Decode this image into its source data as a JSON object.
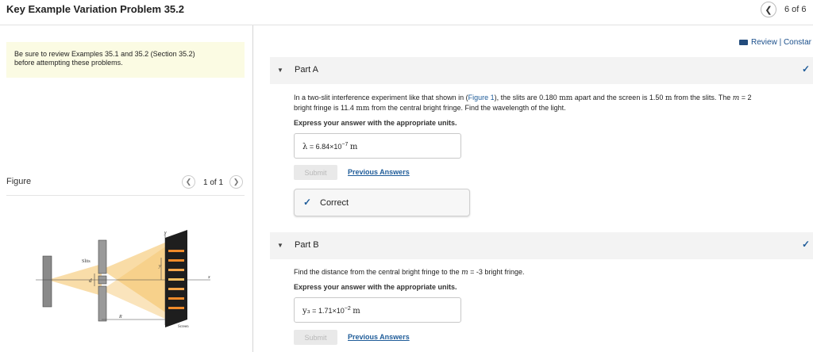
{
  "header": {
    "title": "Key Example Variation Problem 35.2",
    "prev_icon": "chevron-left",
    "page_count": "6 of 6"
  },
  "review_note": {
    "line1": "Be sure to review Examples 35.1 and 35.2 (Section 35.2)",
    "line2": "before attempting these problems."
  },
  "figure_panel": {
    "label": "Figure",
    "prev_icon": "chevron-left",
    "next_icon": "chevron-right",
    "count": "1 of 1",
    "labels": {
      "slits": "Slits",
      "y": "y",
      "y_sub": "y",
      "d": "d",
      "x": "x",
      "R": "R",
      "screen": "Screen"
    }
  },
  "review_link": {
    "icon": "book-icon",
    "text": "Review | Constar"
  },
  "part_a": {
    "label": "Part A",
    "q_line1_pre": "In a two-slit interference experiment like that shown in (",
    "figure_link": "Figure 1",
    "q_line1_post_a": "), the slits are 0.180 ",
    "unit_mm": "mm",
    "q_line1_post_b": " apart and the screen is 1.50 ",
    "unit_m": "m",
    "q_line1_post_c": " from the slits. The ",
    "var_m": "m",
    "q_line1_post_d": " = 2",
    "q_line2_pre": "bright fringe is 11.4 ",
    "q_line2_post": " from the central bright fringe. Find the wavelength of the light.",
    "express": "Express your answer with the appropriate units.",
    "answer_symbol": "λ",
    "answer_eq": " = ",
    "answer_mantissa": "6.84×10",
    "answer_exponent": "−7",
    "answer_unit": "m",
    "submit": "Submit",
    "previous_answers": "Previous Answers",
    "correct": "Correct"
  },
  "part_b": {
    "label": "Part B",
    "q_pre": "Find the distance from the central bright fringe to the ",
    "var_m": "m",
    "q_post": " = -3 bright fringe.",
    "express": "Express your answer with the appropriate units.",
    "answer_symbol": "y₃",
    "answer_eq": " = ",
    "answer_mantissa": "1.71×10",
    "answer_exponent": "−2",
    "answer_unit": "m",
    "submit": "Submit",
    "previous_answers": "Previous Answers"
  },
  "colors": {
    "accent": "#1f5c99",
    "note_bg": "#fbfbe3",
    "part_header_bg": "#f3f3f3",
    "beam": "#f5c46a"
  }
}
